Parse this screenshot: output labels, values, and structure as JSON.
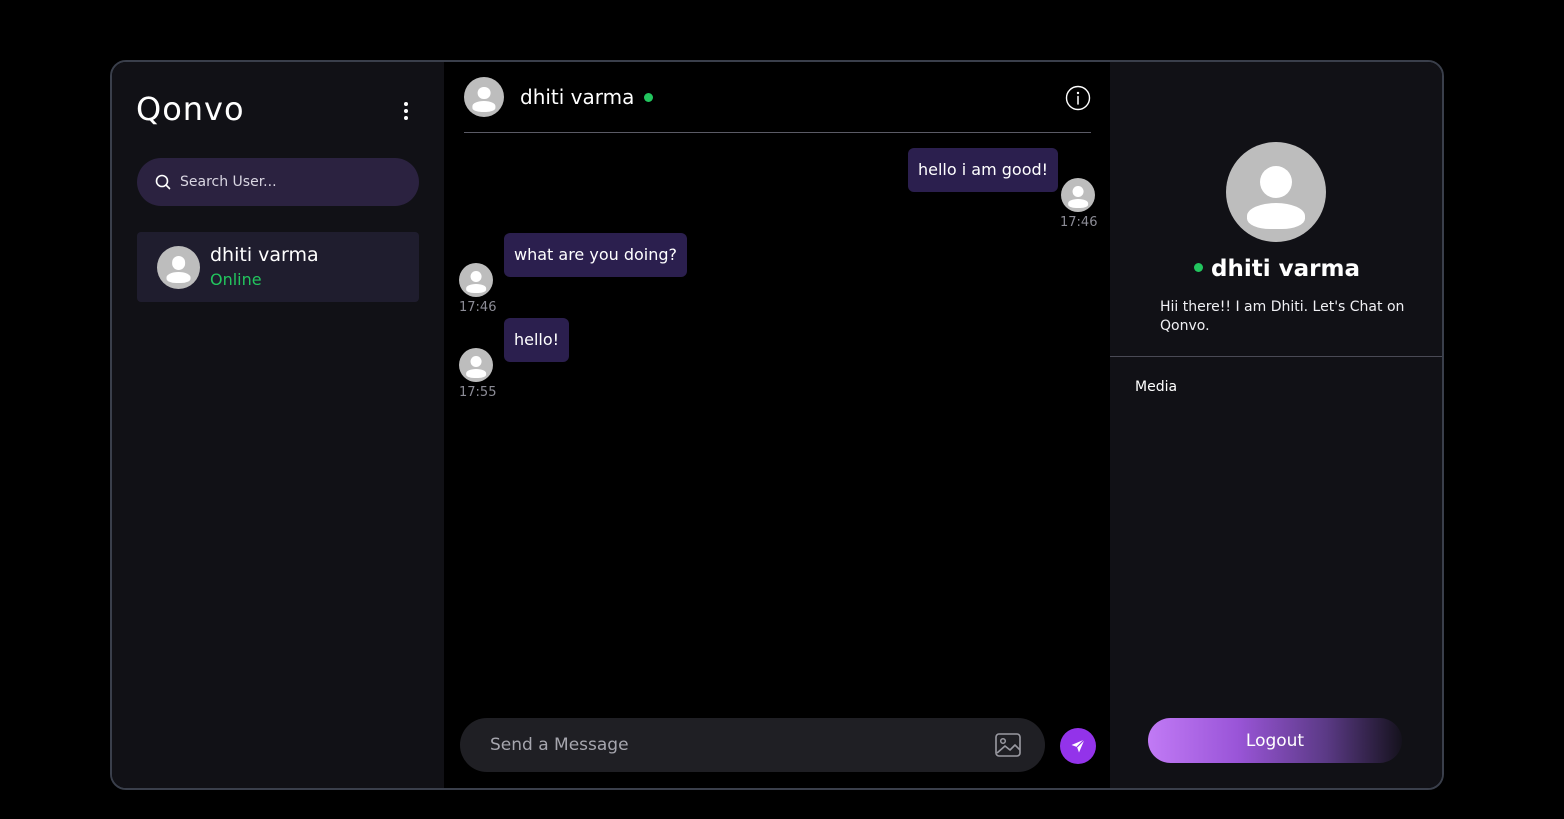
{
  "app": {
    "name": "Qonvo"
  },
  "sidebar": {
    "search_placeholder": "Search User...",
    "users": [
      {
        "name": "dhiti varma",
        "status": "Online"
      }
    ]
  },
  "chat": {
    "title": "dhiti varma",
    "messages": [
      {
        "text": "hello i am good!",
        "time": "17:46",
        "direction": "outgoing"
      },
      {
        "text": "what are you doing?",
        "time": "17:46",
        "direction": "incoming"
      },
      {
        "text": "hello!",
        "time": "17:55",
        "direction": "incoming"
      }
    ],
    "composer_placeholder": "Send a Message"
  },
  "profile": {
    "name": "dhiti varma",
    "bio": "Hii there!! I am Dhiti. Let's Chat on Qonvo.",
    "media_label": "Media",
    "logout_label": "Logout"
  },
  "colors": {
    "accent": "#9333ea",
    "online": "#22c55e",
    "bubble": "#2b1f4e"
  }
}
